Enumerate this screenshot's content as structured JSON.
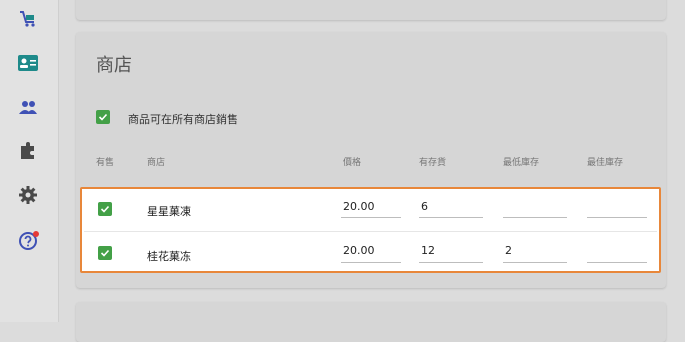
{
  "store_section": {
    "title": "商店",
    "sell_all_label": "商品可在所有商店銷售",
    "sell_all_checked": true,
    "columns": [
      "有售",
      "商店",
      "價格",
      "有存貨",
      "最低庫存",
      "最佳庫存"
    ],
    "rows": [
      {
        "available": true,
        "store": "星星菓凍",
        "price": "20.00",
        "stock": "6",
        "min_stock": "",
        "best_stock": ""
      },
      {
        "available": true,
        "store": "桂花菓冻",
        "price": "20.00",
        "stock": "12",
        "min_stock": "2",
        "best_stock": ""
      }
    ]
  },
  "sidebar": {
    "icons": [
      "cart-icon",
      "id-card-icon",
      "people-icon",
      "puzzle-icon",
      "gear-icon",
      "help-icon"
    ]
  },
  "colors": {
    "accent_green": "#43a047",
    "highlight_orange": "#e8873a",
    "icon_teal": "#1e8a8a",
    "icon_blue": "#3f51b5",
    "badge_red": "#e53935"
  }
}
